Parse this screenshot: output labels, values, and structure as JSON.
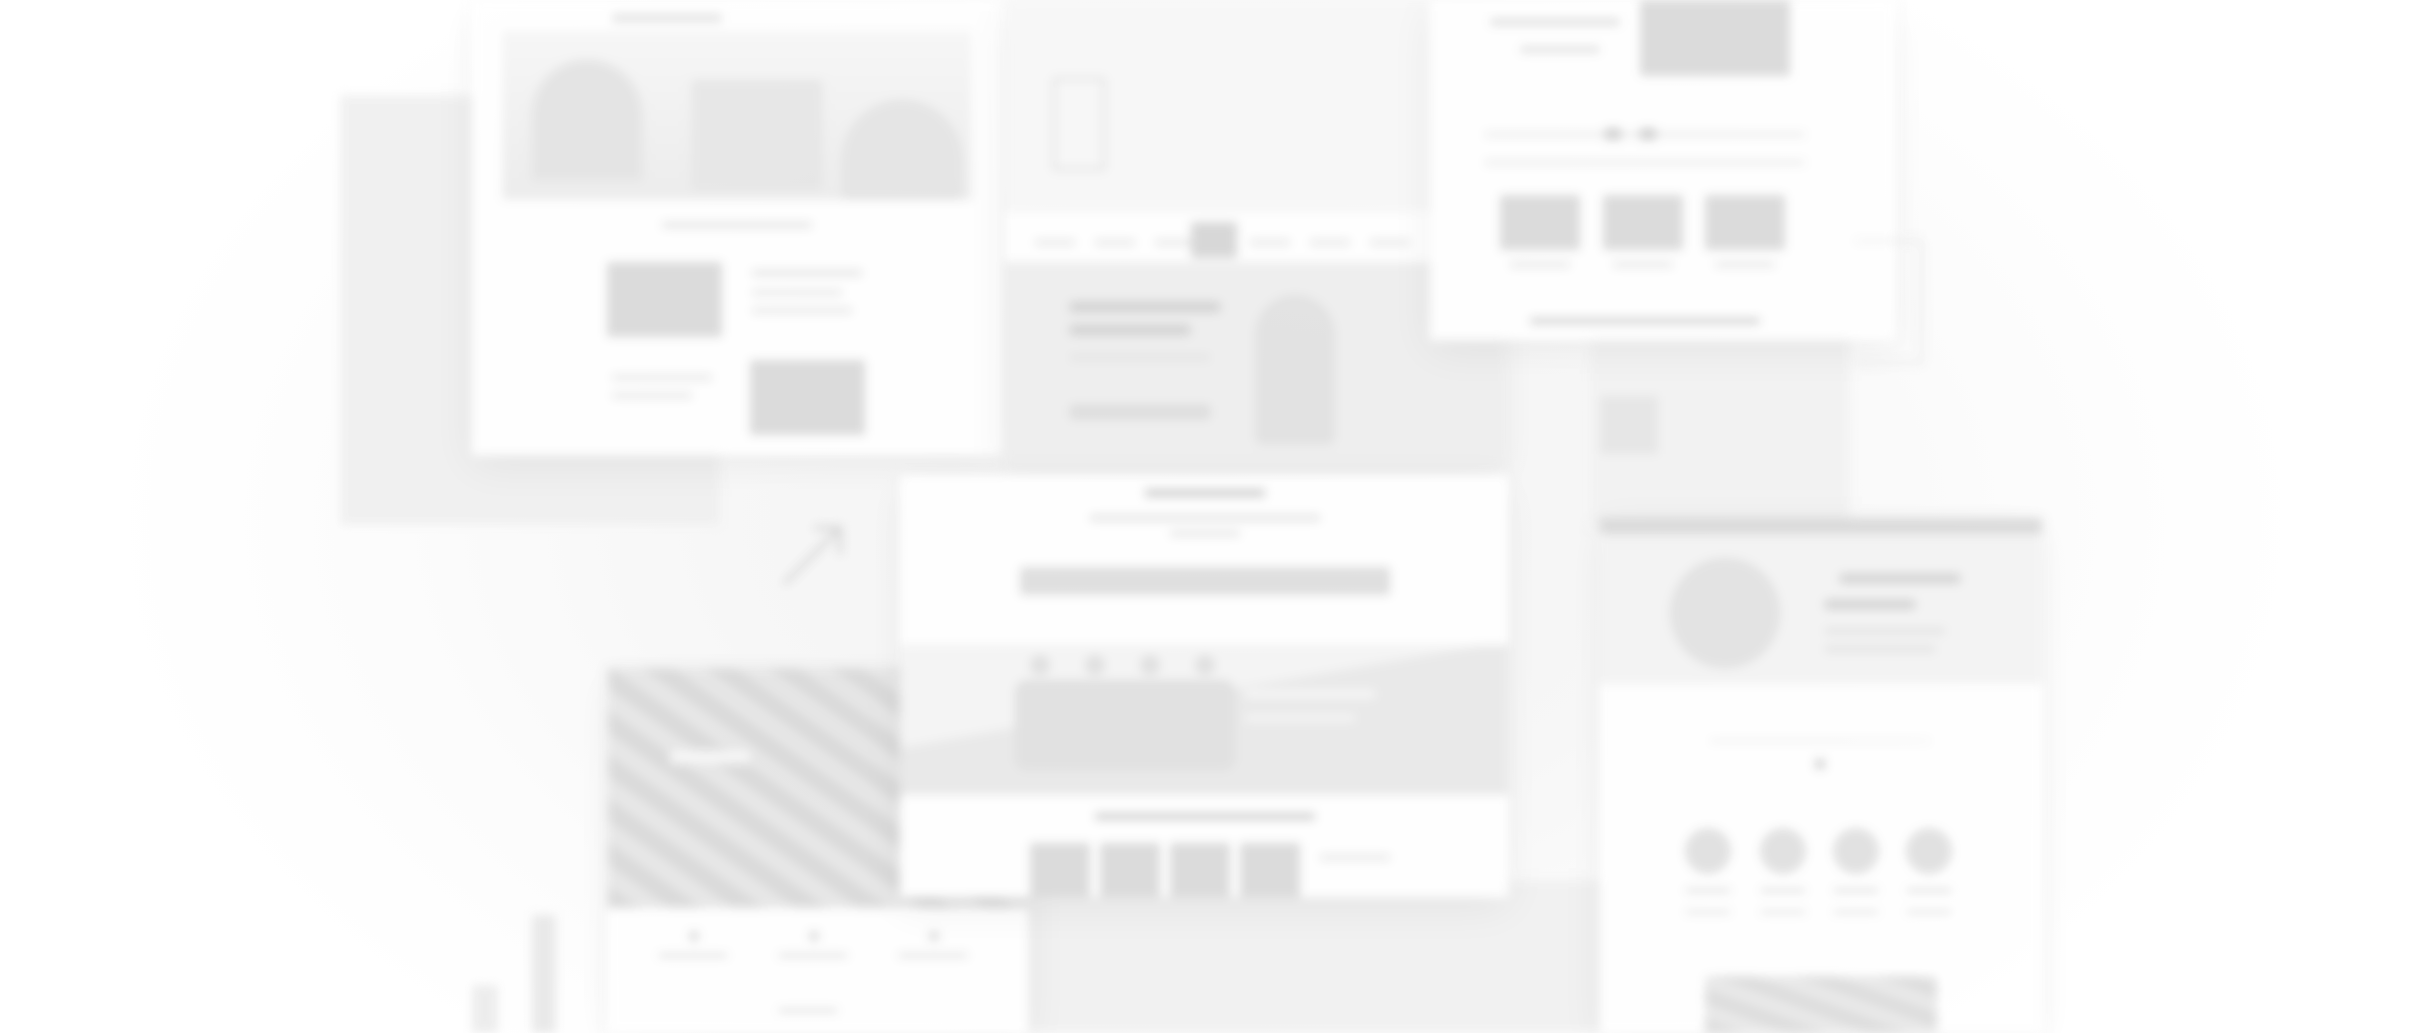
{
  "scene": "blurred-website-mockups-collage",
  "colors": {
    "background": "#ffffff",
    "card": "#ffffff",
    "placeholder": "#dadada"
  },
  "icons": [
    "arrow-up-right-icon"
  ]
}
